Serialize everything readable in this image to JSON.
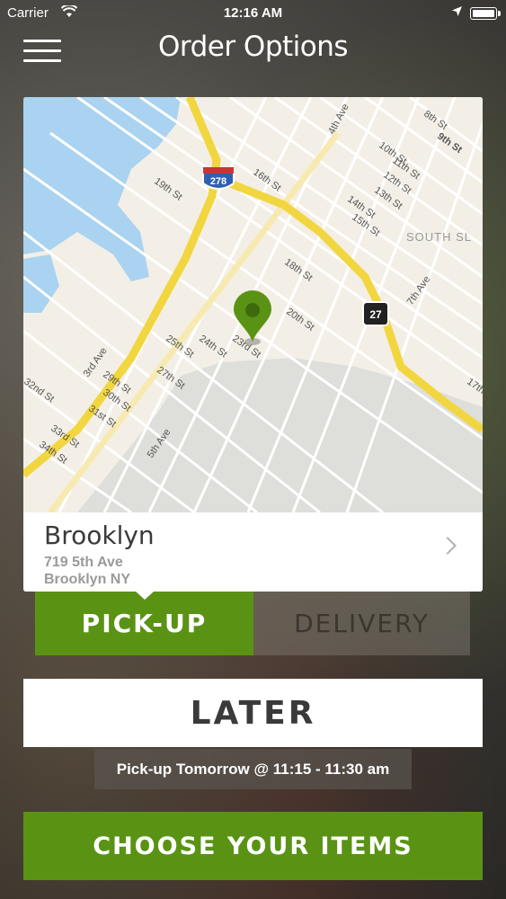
{
  "status_bar": {
    "carrier": "Carrier",
    "time": "12:16 AM",
    "icons": [
      "wifi-icon",
      "location-arrow-icon",
      "battery-icon"
    ]
  },
  "header": {
    "title": "Order Options",
    "menu_icon": "hamburger-menu-icon"
  },
  "map": {
    "street_labels": [
      "4th Ave",
      "8th St",
      "9th St",
      "10th St",
      "11th St",
      "12th St",
      "13th St",
      "14th St",
      "15th St",
      "16th St",
      "18th St",
      "19th St",
      "20th St",
      "23rd St",
      "24th St",
      "25th St",
      "27th St",
      "29th St",
      "30th St",
      "31st St",
      "33rd St",
      "34th St",
      "5th Ave",
      "3rd Ave",
      "7th Ave",
      "17th",
      "32nd St",
      "SOUTH SL"
    ],
    "shields": [
      "278",
      "27"
    ],
    "pin_color": "#5a9314"
  },
  "location": {
    "name": "Brooklyn",
    "address_line1": "719 5th Ave",
    "address_line2": "Brooklyn NY"
  },
  "tabs": {
    "pickup_label": "PICK-UP",
    "delivery_label": "DELIVERY",
    "selected": "PICK-UP"
  },
  "timing": {
    "later_label": "LATER",
    "schedule_text": "Pick-up Tomorrow @ 11:15 - 11:30 am"
  },
  "actions": {
    "choose_label": "CHOOSE YOUR ITEMS"
  },
  "colors": {
    "accent_green": "#5a9314",
    "highway_yellow": "#f2d640",
    "water_blue": "#a9d3f0"
  }
}
